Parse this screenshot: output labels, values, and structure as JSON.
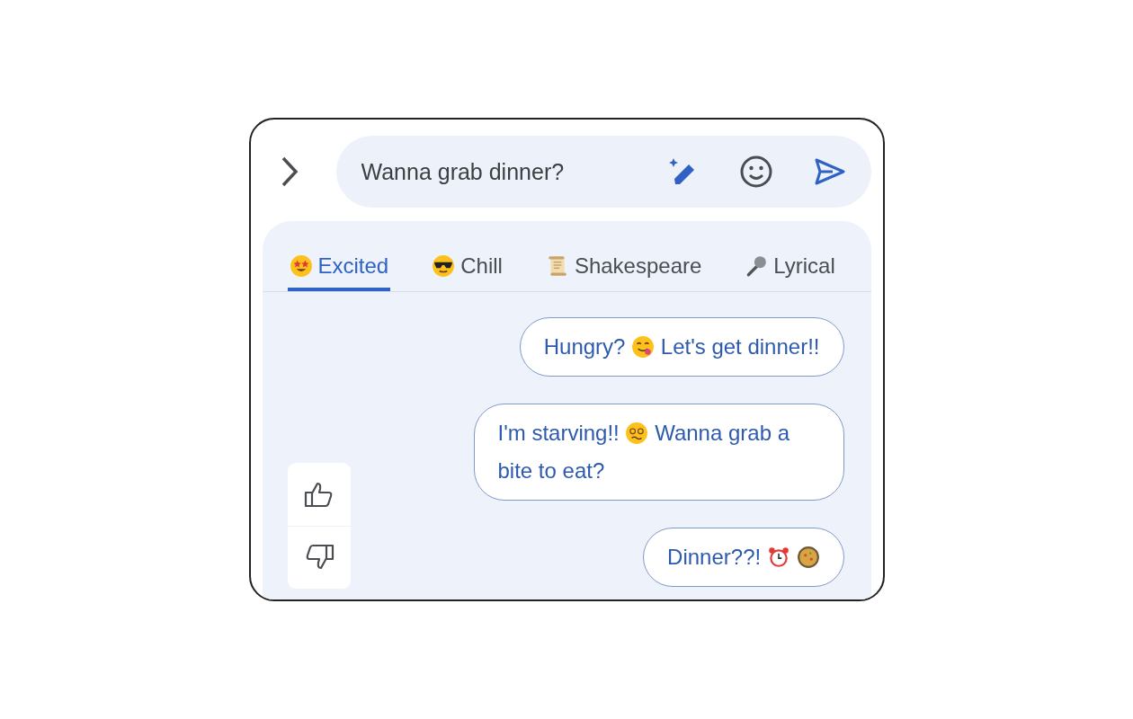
{
  "expand_button": {
    "kind": "chevron"
  },
  "compose": {
    "value": "Wanna grab dinner?"
  },
  "tabs": [
    {
      "label": "Excited",
      "kind": "star-eyes",
      "selected": true
    },
    {
      "label": "Chill",
      "kind": "sunglasses",
      "selected": false
    },
    {
      "label": "Shakespeare",
      "kind": "scroll",
      "selected": false
    },
    {
      "label": "Lyrical",
      "kind": "microphone",
      "selected": false
    }
  ],
  "suggestions": [
    {
      "parts": [
        {
          "kind": "text",
          "text": "Hungry?"
        },
        {
          "kind": "yum-face"
        },
        {
          "kind": "text",
          "text": "Let's get dinner!!"
        }
      ]
    },
    {
      "parts": [
        {
          "kind": "text",
          "text": "I'm starving!!"
        },
        {
          "kind": "dizzy-face"
        },
        {
          "kind": "text",
          "text": "Wanna grab a bite to eat?"
        }
      ]
    },
    {
      "parts": [
        {
          "kind": "text",
          "text": "Dinner??!"
        },
        {
          "kind": "alarm-clock"
        },
        {
          "kind": "pan"
        }
      ]
    }
  ]
}
